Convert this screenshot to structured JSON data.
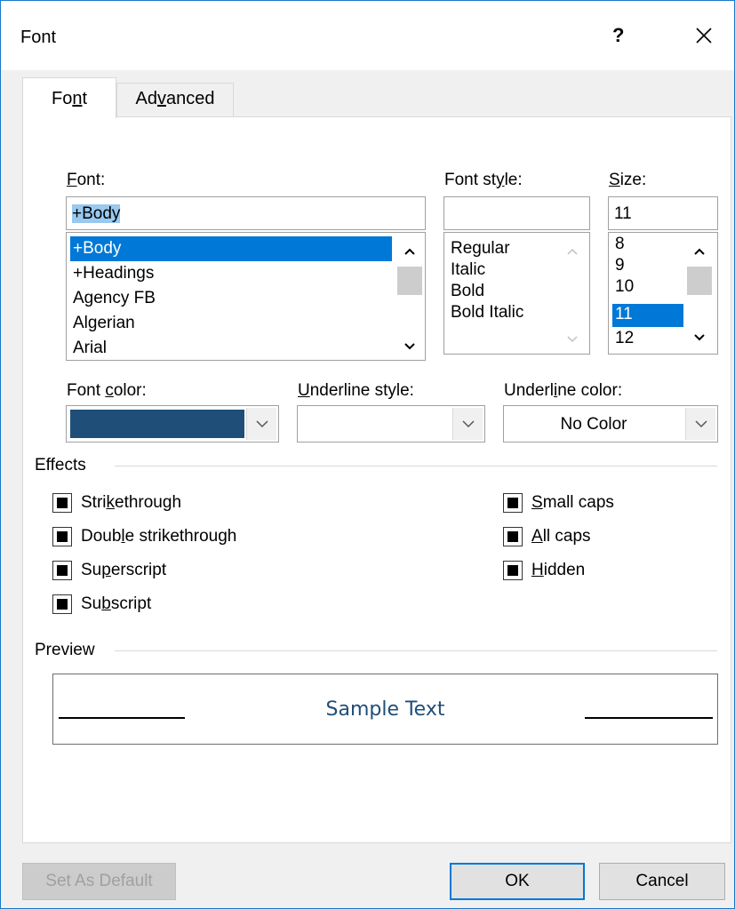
{
  "window": {
    "title": "Font",
    "help": "?"
  },
  "tabs": [
    {
      "label": "Font",
      "underline_index": 2,
      "active": true
    },
    {
      "label": "Advanced",
      "underline_index": 2,
      "active": false
    }
  ],
  "font": {
    "label": "Font:",
    "value": "+Body",
    "items": [
      "+Body",
      "+Headings",
      "Agency FB",
      "Algerian",
      "Arial"
    ],
    "selected": "+Body"
  },
  "font_style": {
    "label": "Font style:",
    "value": "",
    "items": [
      "Regular",
      "Italic",
      "Bold",
      "Bold Italic"
    ]
  },
  "size": {
    "label": "Size:",
    "value": "11",
    "items": [
      "8",
      "9",
      "10",
      "11",
      "12"
    ],
    "selected": "11"
  },
  "font_color": {
    "label": "Font color:",
    "color": "#1f4e79"
  },
  "underline_style": {
    "label": "Underline style:",
    "value": ""
  },
  "underline_color": {
    "label": "Underline color:",
    "value": "No Color"
  },
  "effects": {
    "label": "Effects",
    "left": [
      {
        "label": "Strikethrough",
        "state": "indeterminate"
      },
      {
        "label": "Double strikethrough",
        "state": "indeterminate"
      },
      {
        "label": "Superscript",
        "state": "indeterminate"
      },
      {
        "label": "Subscript",
        "state": "indeterminate"
      }
    ],
    "right": [
      {
        "label": "Small caps",
        "state": "indeterminate"
      },
      {
        "label": "All caps",
        "state": "indeterminate"
      },
      {
        "label": "Hidden",
        "state": "indeterminate"
      }
    ]
  },
  "preview": {
    "label": "Preview",
    "sample": "Sample Text"
  },
  "buttons": {
    "set_default": "Set As Default",
    "ok": "OK",
    "cancel": "Cancel"
  },
  "colors": {
    "accent": "#0078d7",
    "window_border": "#1979ca",
    "sample_text": "#1f4e79"
  }
}
